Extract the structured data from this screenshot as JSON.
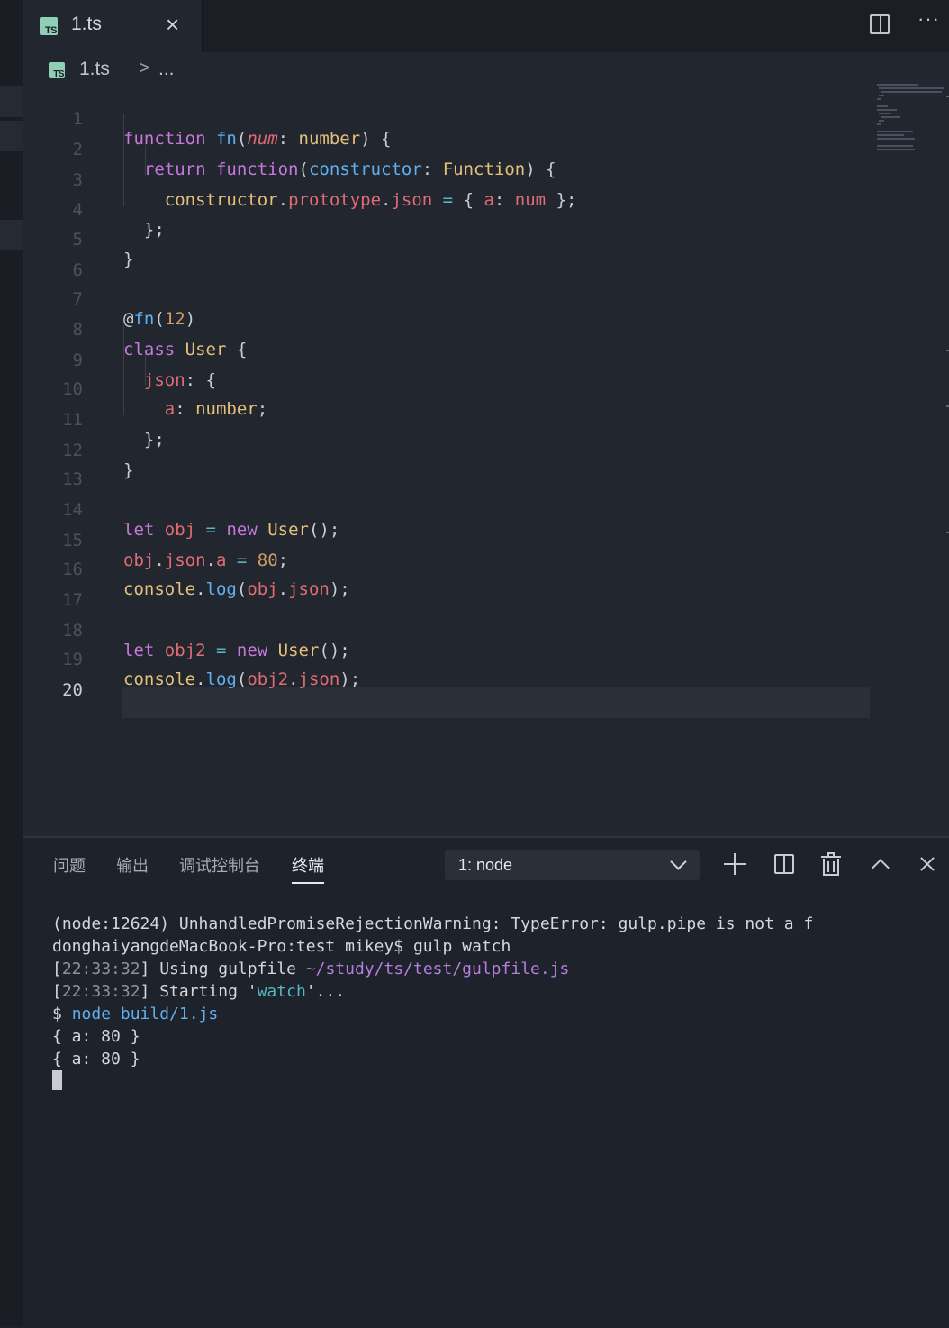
{
  "tab": {
    "label": "1.ts",
    "close": "×",
    "lang_badge": "TS"
  },
  "breadcrumb": {
    "file": "1.ts",
    "separator": ">",
    "more": "..."
  },
  "editor": {
    "line_numbers": [
      "1",
      "2",
      "3",
      "4",
      "5",
      "6",
      "7",
      "8",
      "9",
      "10",
      "11",
      "12",
      "13",
      "14",
      "15",
      "16",
      "17",
      "18",
      "19",
      "20"
    ]
  },
  "code": {
    "l1": {
      "a": "function",
      "b": "fn",
      "c": "(",
      "d": "num",
      "e": ": ",
      "f": "number",
      "g": ") {"
    },
    "l2": {
      "a": "return",
      "b": "function",
      "c": "(",
      "d": "constructor",
      "e": ": ",
      "f": "Function",
      "g": ") {"
    },
    "l3": {
      "a": "constructor",
      "b": ".",
      "c": "prototype",
      "d": ".",
      "e": "json",
      "f": " = ",
      "g": "{ ",
      "h": "a",
      "i": ": ",
      "j": "num",
      "k": " };"
    },
    "l4": {
      "a": "};"
    },
    "l5": {
      "a": "}"
    },
    "l7": {
      "a": "@",
      "b": "fn",
      "c": "(",
      "d": "12",
      "e": ")"
    },
    "l8": {
      "a": "class",
      "b": "User",
      "c": " {"
    },
    "l9": {
      "a": "json",
      "b": ": {"
    },
    "l10": {
      "a": "a",
      "b": ": ",
      "c": "number",
      "d": ";"
    },
    "l11": {
      "a": "};"
    },
    "l12": {
      "a": "}"
    },
    "l14": {
      "a": "let",
      "b": "obj",
      "c": " = ",
      "d": "new",
      "e": "User",
      "f": "();"
    },
    "l15": {
      "a": "obj",
      "b": ".",
      "c": "json",
      "d": ".",
      "e": "a",
      "f": " = ",
      "g": "80",
      "h": ";"
    },
    "l16": {
      "a": "console",
      "b": ".",
      "c": "log",
      "d": "(",
      "e": "obj",
      "f": ".",
      "g": "json",
      "h": ");"
    },
    "l18": {
      "a": "let",
      "b": "obj2",
      "c": " = ",
      "d": "new",
      "e": "User",
      "f": "();"
    },
    "l19": {
      "a": "console",
      "b": ".",
      "c": "log",
      "d": "(",
      "e": "obj2",
      "f": ".",
      "g": "json",
      "h": ");"
    }
  },
  "panel": {
    "tabs": [
      "问题",
      "输出",
      "调试控制台",
      "终端"
    ],
    "terminal_select": "1: node"
  },
  "terminal": {
    "l1": "(node:12624) UnhandledPromiseRejectionWarning: TypeError: gulp.pipe is not a f",
    "l2": "donghaiyangdeMacBook-Pro:test mikey$ gulp watch",
    "l3": {
      "a": "[",
      "b": "22:33:32",
      "c": "] Using gulpfile ",
      "d": "~/study/ts/test/gulpfile.js"
    },
    "l4": {
      "a": "[",
      "b": "22:33:32",
      "c": "] Starting '",
      "d": "watch",
      "e": "'..."
    },
    "l5": {
      "a": "$ ",
      "b": "node build/1.js"
    },
    "l6": "{ a: 80 }",
    "l7": "{ a: 80 }"
  },
  "colors": {
    "background": "#22262e",
    "keyword": "#c678dd",
    "function": "#61afef",
    "type": "#e5c07b",
    "variable": "#e06c75",
    "number": "#d19a66"
  }
}
